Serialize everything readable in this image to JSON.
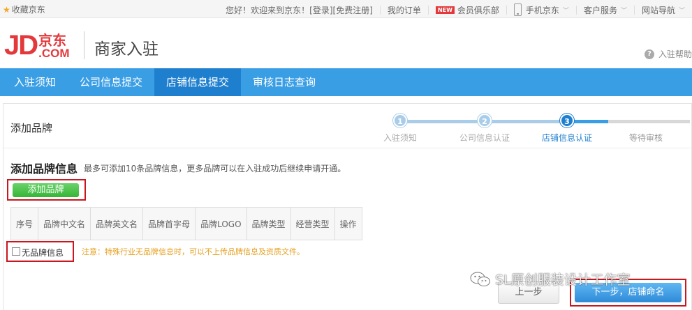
{
  "topbar": {
    "favorite": "收藏京东",
    "welcome": "您好！欢迎来到京东！",
    "login": "[登录]",
    "register": "[免费注册]",
    "my_orders": "我的订单",
    "new_badge": "NEW",
    "vip_club": "会员俱乐部",
    "mobile_jd": "手机京东",
    "customer_service": "客户服务",
    "site_nav": "网站导航"
  },
  "header": {
    "logo_jd": "JD",
    "logo_cn": "京东",
    "logo_com": ".COM",
    "title": "商家入驻",
    "help": "入驻帮助"
  },
  "nav": {
    "tabs": [
      {
        "label": "入驻须知"
      },
      {
        "label": "公司信息提交"
      },
      {
        "label": "店铺信息提交"
      },
      {
        "label": "审核日志查询"
      }
    ],
    "active_index": 2
  },
  "panel": {
    "title": "添加品牌"
  },
  "steps": [
    {
      "num": "1",
      "label": "入驻须知",
      "state": "done"
    },
    {
      "num": "2",
      "label": "公司信息认证",
      "state": "done"
    },
    {
      "num": "3",
      "label": "店铺信息认证",
      "state": "current"
    },
    {
      "num": "",
      "label": "等待审核",
      "state": "todo"
    }
  ],
  "brand_section": {
    "title": "添加品牌信息",
    "note": "最多可添加10条品牌信息，更多品牌可以在入驻成功后继续申请开通。",
    "add_button": "添加品牌"
  },
  "table": {
    "headers": [
      "序号",
      "品牌中文名",
      "品牌英文名",
      "品牌首字母",
      "品牌LOGO",
      "品牌类型",
      "经营类型",
      "操作"
    ]
  },
  "no_brand": {
    "label": "无品牌信息",
    "note": "注意：特殊行业无品牌信息时，可以不上传品牌信息及资质文件。"
  },
  "footer_buttons": {
    "prev": "上一步",
    "next": "下一步，店铺命名"
  },
  "watermark": "SL原创服装设计工作室",
  "colors": {
    "nav_blue": "#3a9ee5",
    "nav_active": "#1f7fcf",
    "jd_red": "#e4393c",
    "highlight_red": "#c8171e",
    "add_green": "#35b535",
    "warning_orange": "#e6a020"
  }
}
